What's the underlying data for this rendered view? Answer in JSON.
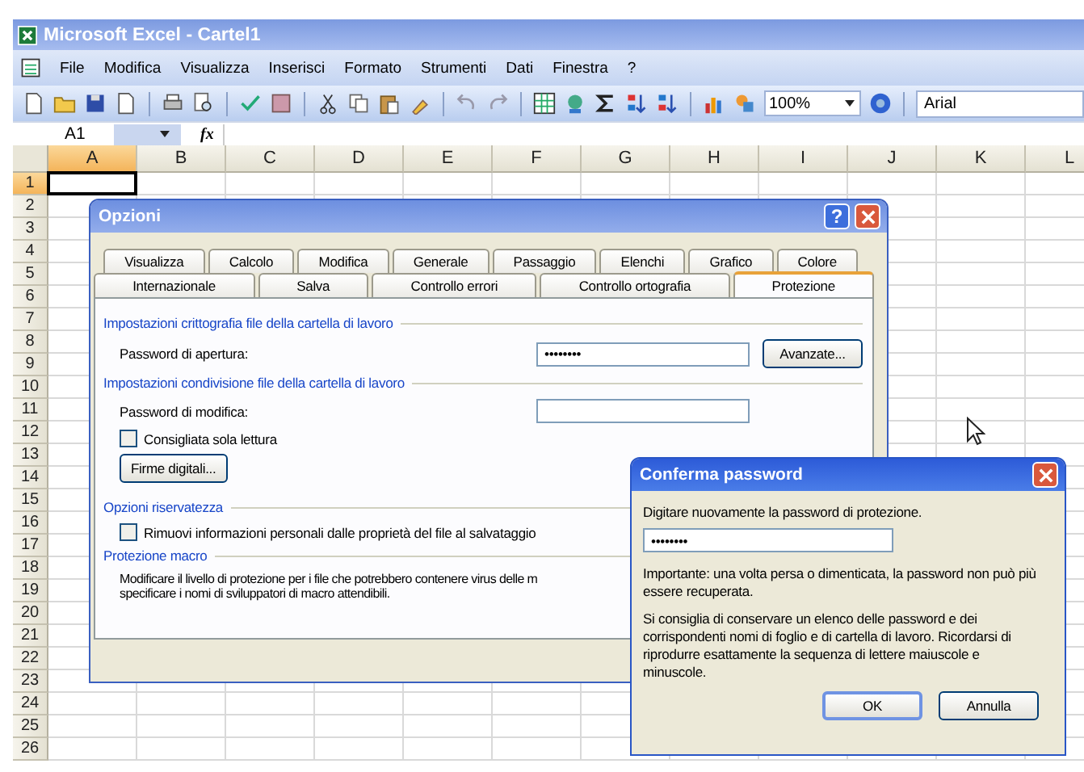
{
  "window": {
    "title": "Microsoft Excel - Cartel1"
  },
  "menu": [
    "File",
    "Modifica",
    "Visualizza",
    "Inserisci",
    "Formato",
    "Strumenti",
    "Dati",
    "Finestra",
    "?"
  ],
  "toolbar": {
    "zoom": "100%",
    "font": "Arial"
  },
  "formula_bar": {
    "name_box": "A1",
    "function_label": "fx"
  },
  "sheet": {
    "columns": [
      {
        "label": "A",
        "selected": true
      },
      {
        "label": "B",
        "selected": false
      },
      {
        "label": "C",
        "selected": false
      },
      {
        "label": "D",
        "selected": false
      },
      {
        "label": "E",
        "selected": false
      },
      {
        "label": "F",
        "selected": false
      },
      {
        "label": "G",
        "selected": false
      },
      {
        "label": "H",
        "selected": false
      },
      {
        "label": "I",
        "selected": false
      },
      {
        "label": "J",
        "selected": false
      },
      {
        "label": "K",
        "selected": false
      },
      {
        "label": "L",
        "selected": false
      }
    ],
    "rows": [
      {
        "label": "1",
        "selected": true
      },
      {
        "label": "2",
        "selected": false
      },
      {
        "label": "3",
        "selected": false
      },
      {
        "label": "4",
        "selected": false
      },
      {
        "label": "5",
        "selected": false
      },
      {
        "label": "6",
        "selected": false
      },
      {
        "label": "7",
        "selected": false
      },
      {
        "label": "8",
        "selected": false
      },
      {
        "label": "9",
        "selected": false
      },
      {
        "label": "10",
        "selected": false
      },
      {
        "label": "11",
        "selected": false
      },
      {
        "label": "12",
        "selected": false
      },
      {
        "label": "13",
        "selected": false
      },
      {
        "label": "14",
        "selected": false
      },
      {
        "label": "15",
        "selected": false
      },
      {
        "label": "16",
        "selected": false
      },
      {
        "label": "17",
        "selected": false
      },
      {
        "label": "18",
        "selected": false
      },
      {
        "label": "19",
        "selected": false
      },
      {
        "label": "20",
        "selected": false
      },
      {
        "label": "21",
        "selected": false
      },
      {
        "label": "22",
        "selected": false
      },
      {
        "label": "23",
        "selected": false
      },
      {
        "label": "24",
        "selected": false
      },
      {
        "label": "25",
        "selected": false
      },
      {
        "label": "26",
        "selected": false
      }
    ]
  },
  "options_dialog": {
    "title": "Opzioni",
    "help_button": "?",
    "tab_rows": [
      {
        "tabs": [
          {
            "label": "Visualizza",
            "selected": false
          },
          {
            "label": "Calcolo",
            "selected": false
          },
          {
            "label": "Modifica",
            "selected": false
          },
          {
            "label": "Generale",
            "selected": false
          },
          {
            "label": "Passaggio",
            "selected": false
          },
          {
            "label": "Elenchi",
            "selected": false
          },
          {
            "label": "Grafico",
            "selected": false
          },
          {
            "label": "Colore",
            "selected": false
          }
        ]
      },
      {
        "tabs": [
          {
            "label": "Internazionale",
            "selected": false
          },
          {
            "label": "Salva",
            "selected": false
          },
          {
            "label": "Controllo errori",
            "selected": false
          },
          {
            "label": "Controllo ortografia",
            "selected": false
          },
          {
            "label": "Protezione",
            "selected": true
          }
        ]
      }
    ],
    "sections": [
      {
        "title": "Impostazioni crittografia file della cartella di lavoro",
        "items": [
          {
            "kind": "password",
            "label": "Password di apertura:",
            "value": "••••••••",
            "button": "Avanzate..."
          }
        ]
      },
      {
        "title": "Impostazioni condivisione file della cartella di lavoro",
        "items": [
          {
            "kind": "password",
            "label": "Password di modifica:"
          },
          {
            "kind": "checkbox",
            "label": "Consigliata sola lettura",
            "checked": false
          },
          {
            "kind": "button",
            "label": "Firme digitali..."
          }
        ]
      },
      {
        "title": "Opzioni riservatezza",
        "items": [
          {
            "kind": "checkbox",
            "label": "Rimuovi informazioni personali dalle proprietà del file al salvataggio",
            "checked": false
          }
        ]
      },
      {
        "title": "Protezione macro",
        "items": [
          {
            "kind": "text",
            "lines": [
              "Modificare il livello di protezione per i file che potrebbero contenere virus delle m",
              "specificare i nomi di sviluppatori di macro attendibili."
            ]
          }
        ]
      }
    ]
  },
  "confirm_dialog": {
    "title": "Conferma password",
    "prompt": "Digitare nuovamente la password di protezione.",
    "value": "••••••••",
    "notes": [
      "Importante: una volta persa o dimenticata, la password non può più essere recuperata.",
      "Si consiglia di conservare un elenco delle password e dei corrispondenti nomi di foglio e di cartella di lavoro. Ricordarsi di riprodurre esattamente la sequenza di lettere maiuscole e minuscole."
    ],
    "buttons": [
      "OK",
      "Annulla"
    ]
  }
}
